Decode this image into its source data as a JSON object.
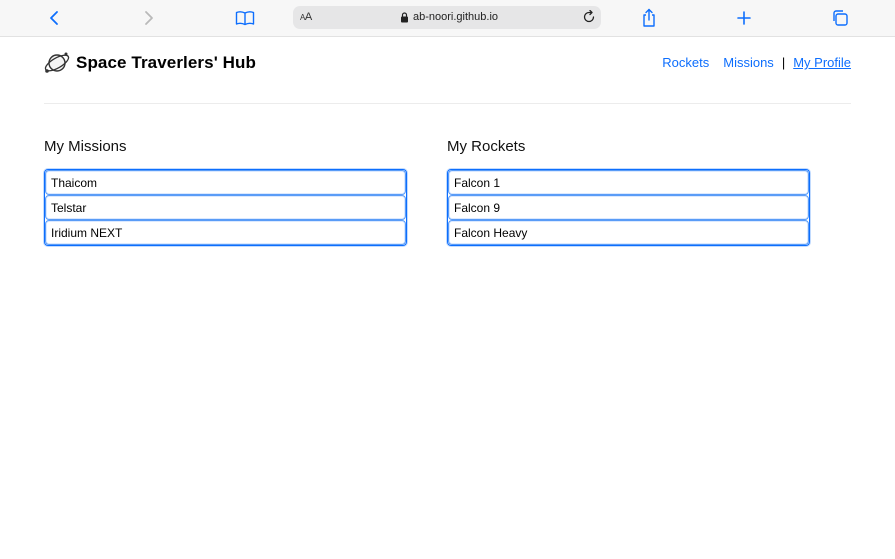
{
  "browser": {
    "url": "ab-noori.github.io",
    "text_size_label_small": "A",
    "text_size_label_large": "A"
  },
  "header": {
    "brand_title": "Space Traverlers' Hub",
    "nav": {
      "rockets": "Rockets",
      "missions": "Missions",
      "separator": "|",
      "my_profile": "My Profile"
    }
  },
  "missions": {
    "heading": "My Missions",
    "items": [
      "Thaicom",
      "Telstar",
      "Iridium NEXT"
    ]
  },
  "rockets": {
    "heading": "My Rockets",
    "items": [
      "Falcon 1",
      "Falcon 9",
      "Falcon Heavy"
    ]
  },
  "colors": {
    "accent": "#0d6efd",
    "toolbar_bg": "#f7f7f7",
    "address_bg": "#e6e6e7"
  }
}
